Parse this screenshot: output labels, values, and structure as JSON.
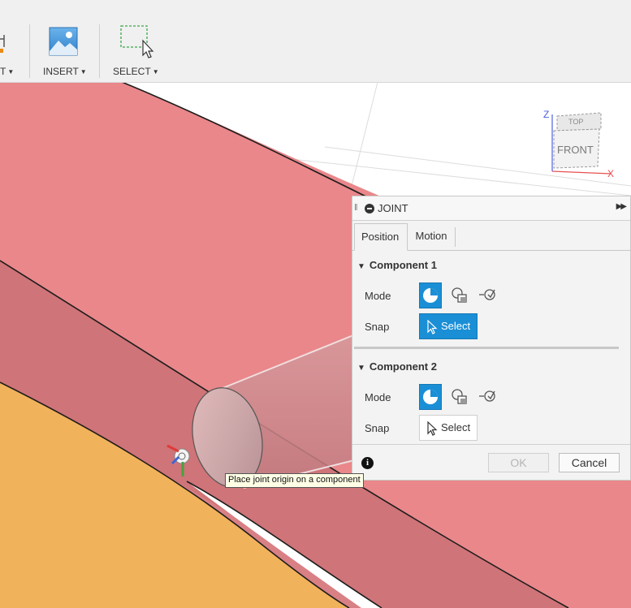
{
  "toolbar": {
    "partial_label": "T",
    "insert_label": "INSERT",
    "select_label": "SELECT"
  },
  "viewcube": {
    "face_label": "FRONT",
    "top_label": "TOP",
    "axis_z": "Z",
    "axis_x": "X"
  },
  "joint_panel": {
    "title": "JOINT",
    "tabs": [
      {
        "label": "Position",
        "active": true
      },
      {
        "label": "Motion",
        "active": false
      }
    ],
    "component1": {
      "title": "Component 1",
      "mode_label": "Mode",
      "snap_label": "Snap",
      "select_label": "Select",
      "mode_icons": [
        "simple-mode-icon",
        "between-two-faces-icon",
        "two-edge-intersection-icon"
      ]
    },
    "component2": {
      "title": "Component 2",
      "mode_label": "Mode",
      "snap_label": "Snap",
      "select_label": "Select",
      "mode_icons": [
        "simple-mode-icon",
        "between-two-faces-icon",
        "two-edge-intersection-icon"
      ]
    },
    "ok_label": "OK",
    "cancel_label": "Cancel"
  },
  "tooltip": {
    "text": "Place joint origin on a component"
  },
  "colors": {
    "accent": "#1a8fd6",
    "body_red": "#e9878a",
    "body_red_dark": "#cf7478",
    "body_orange": "#f0b25b"
  }
}
